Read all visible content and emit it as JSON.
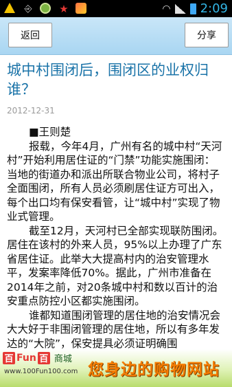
{
  "status_bar": {
    "time": "2:09",
    "icons": [
      "warning-icon",
      "usb-icon",
      "app-status-icon",
      "star-icon",
      "app-notification-icon",
      "wifi-icon",
      "signal-icon",
      "battery-icon"
    ]
  },
  "toolbar": {
    "back_label": "返回",
    "share_label": "分享"
  },
  "article": {
    "title": "城中村围闭后，围闭区的业权归谁？",
    "date": "2012-12-31",
    "author": "■王则楚",
    "paragraphs": [
      "报载，今年4月，广州有名的城中村“天河村”开始利用居住证的“门禁”功能实施围闭：当地的街道办和派出所联合物业公司，将村子全面围闭，所有人员必须刷居住证方可出入，每个出口均有保安看管，让“城中村”实现了物业式管理。",
      "截至12月，天河村已全部实现联防围闭。居住在该村的外来人员，95%以上办理了广东省居住证。此举大大提高村内的治安管理水平，发案率降低70%。据此，广州市准备在2014年之前，对20条城中村和数以百计的治安重点防控小区都实施围闭。",
      "谁都知道围闭管理的居住地的治安情况会大大好于非围闭管理的居住地，所以有多年发达的“大院”，保安提具必须证明确围"
    ]
  },
  "ad": {
    "logo_left": "百",
    "logo_fun": "Fun",
    "logo_right": "百",
    "store": "商城",
    "url": "www.100Fun100.com",
    "slogan": "您身边的购物网站"
  },
  "colors": {
    "toolbar": "#b9dff6",
    "title": "#1a73a8",
    "date": "#9a9a9a",
    "time": "#33b5e5",
    "ad_slogan": "#f57c00"
  }
}
